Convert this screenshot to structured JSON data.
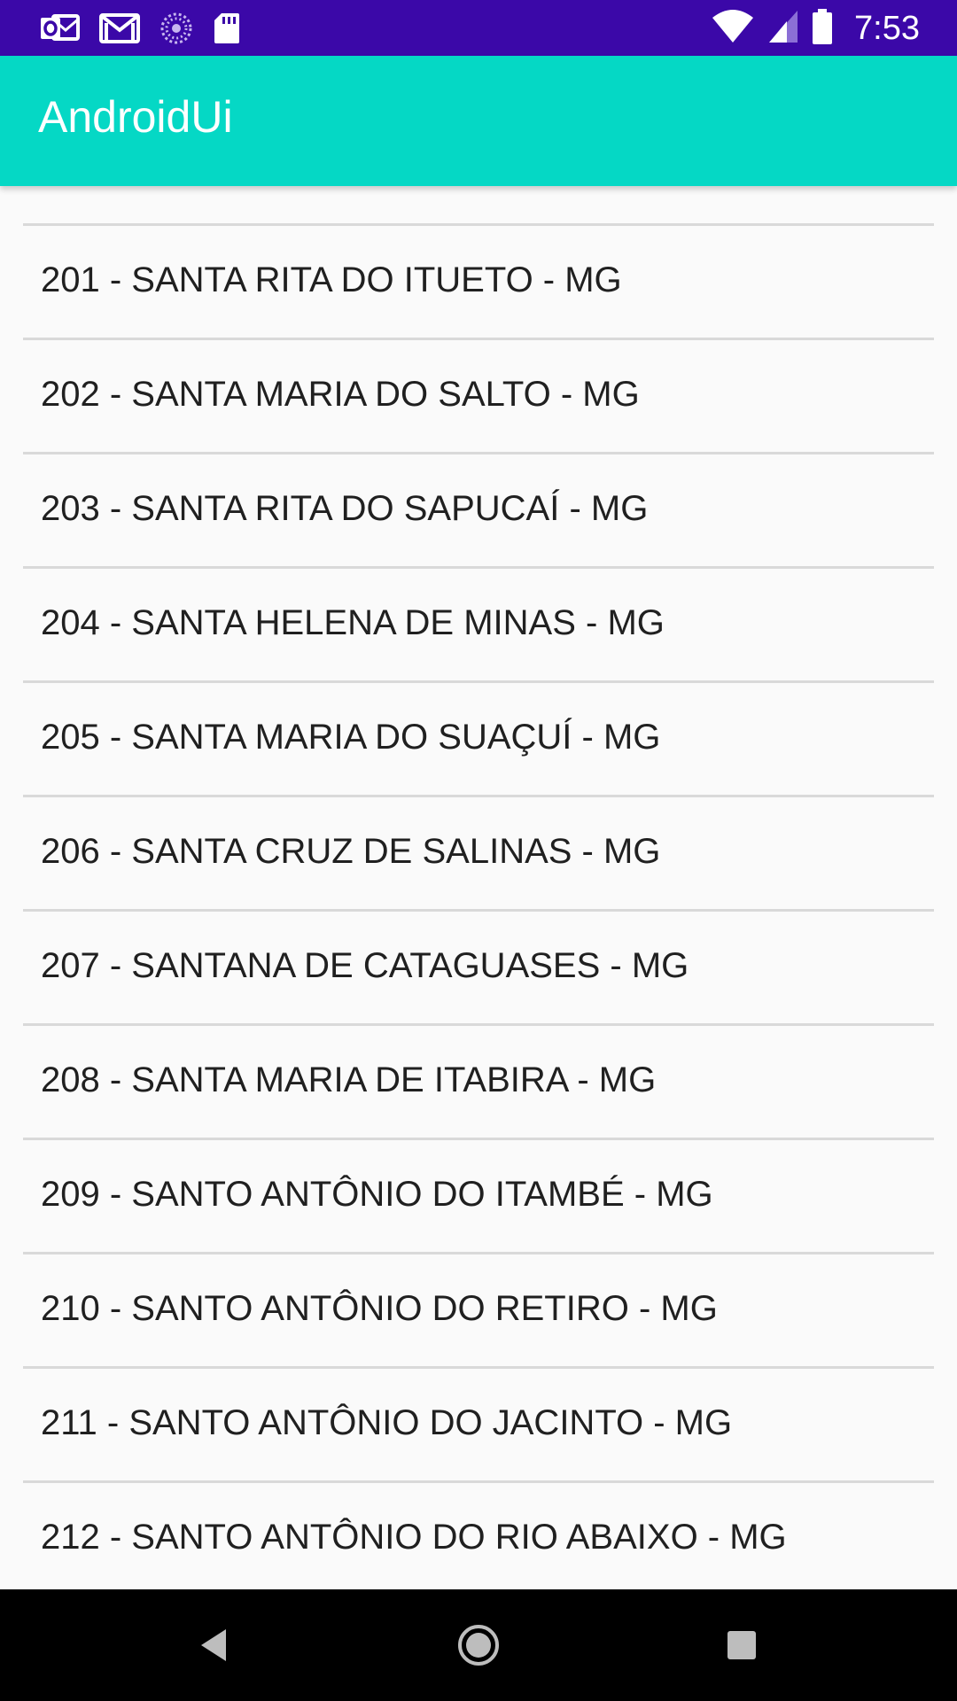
{
  "status_bar": {
    "time": "7:53",
    "background_color": "#3b08a8",
    "left_icons": [
      "outlook-icon",
      "gmail-icon",
      "sync-icon",
      "sd-card-icon"
    ],
    "right_icons": [
      "wifi-icon",
      "signal-icon",
      "battery-icon"
    ]
  },
  "app_bar": {
    "title": "AndroidUi",
    "background_color": "#05d8c5"
  },
  "list": {
    "items": [
      "201 - SANTA RITA DO ITUETO - MG",
      "202 - SANTA MARIA DO SALTO - MG",
      "203 - SANTA RITA DO SAPUCAÍ - MG",
      "204 - SANTA HELENA DE MINAS - MG",
      "205 - SANTA MARIA DO SUAÇUÍ - MG",
      "206 - SANTA CRUZ DE SALINAS - MG",
      "207 - SANTANA DE CATAGUASES - MG",
      "208 - SANTA MARIA DE ITABIRA - MG",
      "209 - SANTO ANTÔNIO DO ITAMBÉ - MG",
      "210 - SANTO ANTÔNIO DO RETIRO - MG",
      "211 - SANTO ANTÔNIO DO JACINTO - MG",
      "212 - SANTO ANTÔNIO DO RIO ABAIXO - MG"
    ]
  },
  "nav_bar": {
    "buttons": [
      "back-icon",
      "home-icon",
      "recents-icon"
    ]
  }
}
